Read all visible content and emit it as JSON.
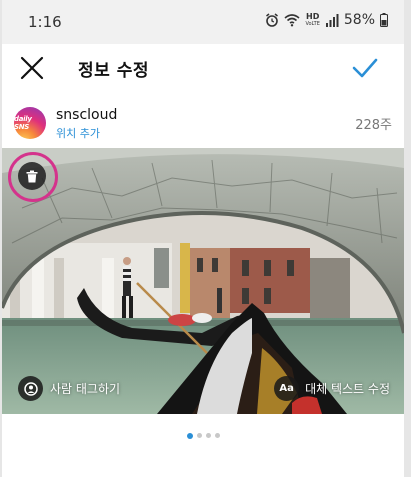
{
  "status_bar": {
    "time": "1:16",
    "network": "HD",
    "network_sub": "VoLTE",
    "battery": "58%"
  },
  "header": {
    "title": "정보 수정",
    "close_icon": "close-icon",
    "done_icon": "checkmark-icon",
    "accent_color": "#2a8fd6"
  },
  "post": {
    "avatar_text": "daily SNS",
    "username": "snscloud",
    "add_location": "위치 추가",
    "age": "228주"
  },
  "photo": {
    "delete_icon": "trash-icon",
    "highlight_color": "#d4338c",
    "tag_people": "사람 태그하기",
    "alt_text_icon": "Aa",
    "alt_text": "대체 텍스트 수정"
  },
  "carousel": {
    "page_count": 4,
    "active_index": 0
  }
}
